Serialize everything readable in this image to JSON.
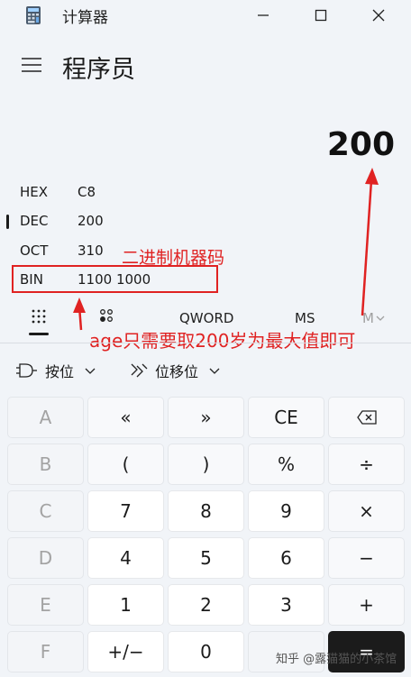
{
  "window": {
    "title": "计算器"
  },
  "header": {
    "mode": "程序员"
  },
  "display": {
    "value": "200"
  },
  "radix": [
    {
      "name": "HEX",
      "value": "C8"
    },
    {
      "name": "DEC",
      "value": "200"
    },
    {
      "name": "OCT",
      "value": "310"
    },
    {
      "name": "BIN",
      "value": "1100 1000"
    }
  ],
  "toolbar": {
    "word_size": "QWORD",
    "memory_store": "MS",
    "memory_menu": "M"
  },
  "bitwise": {
    "bit_label": "按位",
    "shift_label": "位移位"
  },
  "keys": {
    "row1": [
      "A",
      "«",
      "»",
      "CE",
      "⌫"
    ],
    "row2": [
      "B",
      "(",
      ")",
      "%",
      "÷"
    ],
    "row3": [
      "C",
      "7",
      "8",
      "9",
      "×"
    ],
    "row4": [
      "D",
      "4",
      "5",
      "6",
      "−"
    ],
    "row5": [
      "E",
      "1",
      "2",
      "3",
      "+"
    ],
    "row6": [
      "F",
      "+/−",
      "0",
      ".",
      "="
    ]
  },
  "annotations": {
    "binary_note": "二进制机器码",
    "age_note": "age只需要取200岁为最大值即可"
  },
  "watermark": "知乎 @露猫猫的小茶馆",
  "colors": {
    "annotation": "#e02222",
    "accent_key": "#1b1b1b"
  }
}
